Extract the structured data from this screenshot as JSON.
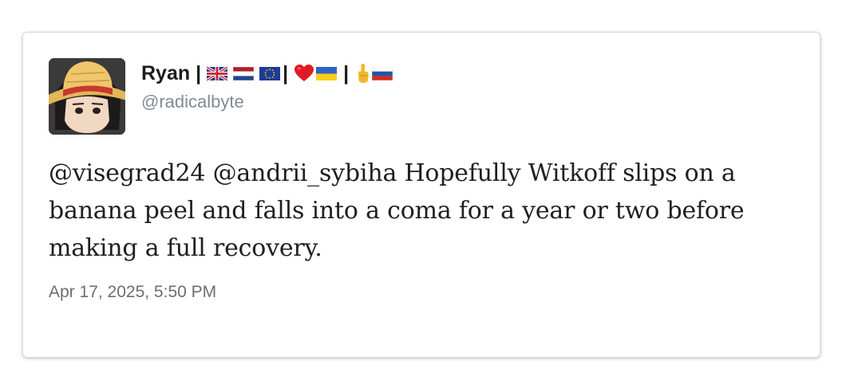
{
  "tweet": {
    "author_name": "Ryan",
    "name_flags": [
      {
        "icon": "uk-flag-icon",
        "after_bar": true
      },
      {
        "icon": "netherlands-flag-icon",
        "after_bar": false
      },
      {
        "icon": "eu-flag-icon",
        "after_bar": false
      }
    ],
    "separator": "|",
    "handle": "@radicalbyte",
    "text": "@visegrad24 @andrii_sybiha Hopefully Witkoff slips on a banana peel and falls into a coma for a year or two before making a full recovery.",
    "timestamp": "Apr 17, 2025, 5:50 PM"
  },
  "icons": {
    "avatar": "avatar-straw-hat-character",
    "heart": "red-heart-icon",
    "ukraine_flag": "ukraine-flag-icon",
    "middle_finger": "middle-finger-emoji-icon",
    "russia_flag": "russia-flag-icon"
  },
  "colors": {
    "handle": "#7d8c96",
    "text": "#1f1f1f",
    "timestamp": "#6e6e6e",
    "card_border": "#dcdcdc"
  }
}
